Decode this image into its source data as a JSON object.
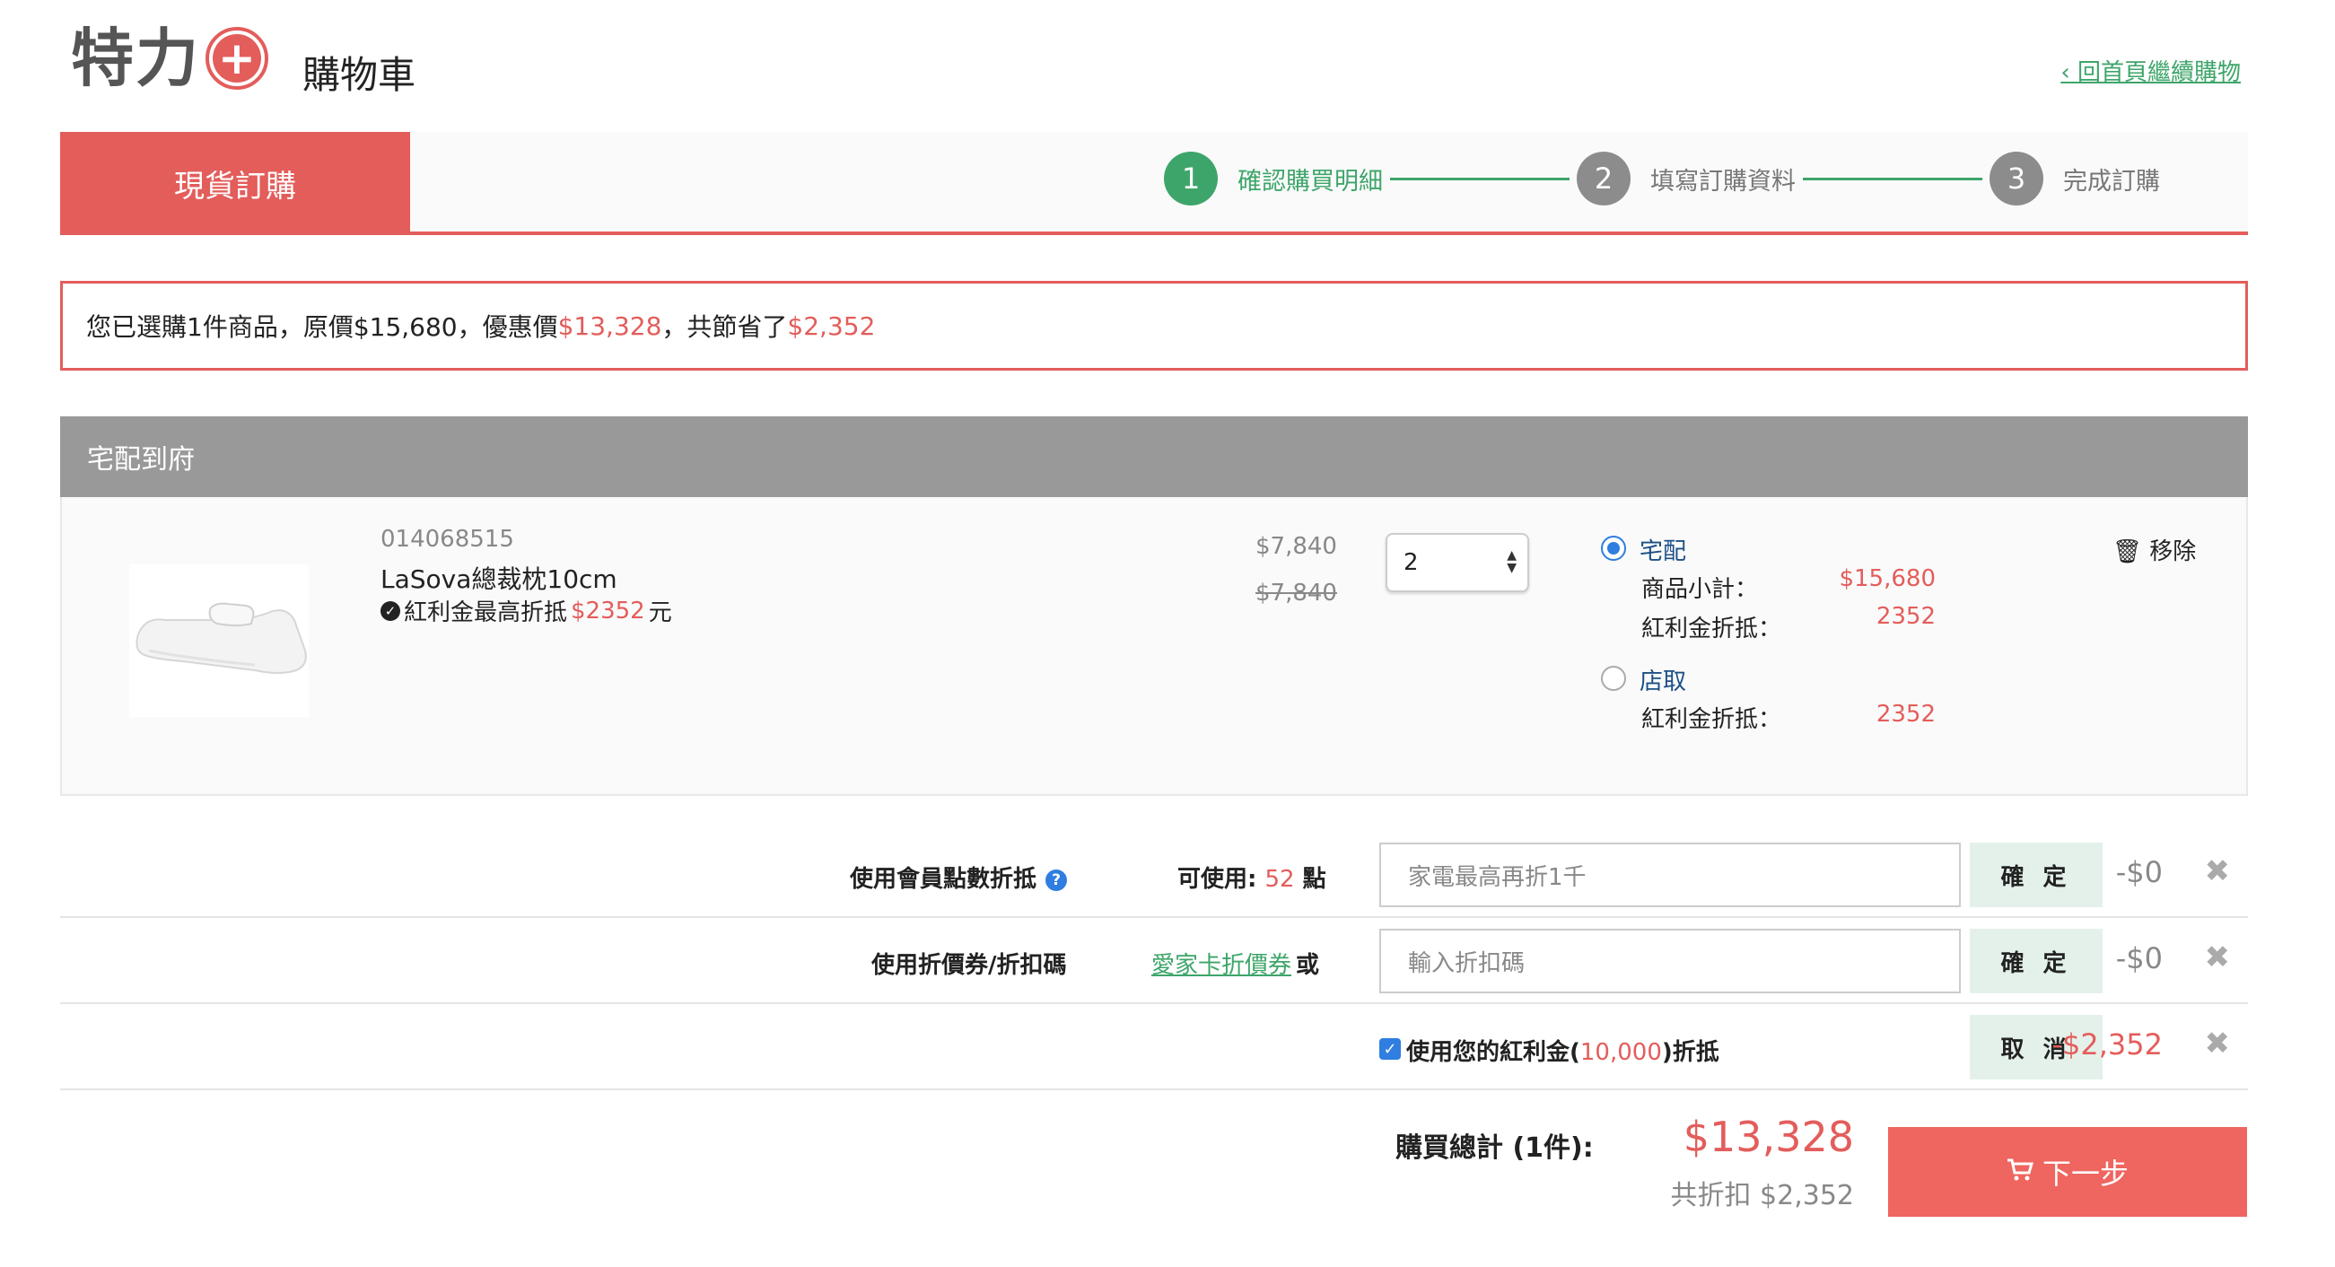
{
  "header": {
    "logo_main": "特力",
    "logo_plus": "+",
    "title": "購物車",
    "back_link": "‹ 回首頁繼續購物"
  },
  "tabs": {
    "active": "現貨訂購"
  },
  "steps": [
    {
      "num": "1",
      "label": "確認購買明細",
      "active": true
    },
    {
      "num": "2",
      "label": "填寫訂購資料",
      "active": false
    },
    {
      "num": "3",
      "label": "完成訂購",
      "active": false
    }
  ],
  "summary": {
    "prefix": "您已選購1件商品，原價$15,680，優惠價",
    "sale_price": "$13,328",
    "middle": "，共節省了",
    "saved": "$2,352"
  },
  "delivery": {
    "section_title": "宅配到府",
    "item": {
      "sku": "014068515",
      "name": "LaSova總裁枕10cm",
      "rebate_prefix": "紅利金最高折抵",
      "rebate_amount": "$2352",
      "rebate_suffix": "元",
      "price": "$7,840",
      "price_old": "$7,840",
      "quantity": "2",
      "remove_label": "移除"
    },
    "options": {
      "home": {
        "label": "宅配",
        "selected": true,
        "subtotal_label": "商品小計：",
        "subtotal_value": "$15,680",
        "rebate_label": "紅利金折抵：",
        "rebate_value": "2352"
      },
      "store": {
        "label": "店取",
        "selected": false,
        "rebate_label": "紅利金折抵：",
        "rebate_value": "2352"
      }
    }
  },
  "discounts": {
    "points": {
      "label": "使用會員點數折抵",
      "available_prefix": "可使用:",
      "available_points": "52",
      "available_suffix": "點",
      "placeholder": "家電最高再折1千",
      "button": "確 定",
      "amount": "-$0"
    },
    "coupon": {
      "label": "使用折價券/折扣碼",
      "link": "愛家卡折價券",
      "or": "或",
      "placeholder": "輸入折扣碼",
      "button": "確 定",
      "amount": "-$0"
    },
    "bonus": {
      "label_prefix": "使用您的紅利金(",
      "bonus_amount": "10,000",
      "label_suffix": ")折抵",
      "checked": true,
      "button": "取 消",
      "amount": "-$2,352"
    }
  },
  "total": {
    "label": "購買總計 (1件):",
    "amount": "$13,328",
    "discount": "共折扣 $2,352",
    "next_button": "下一步"
  },
  "colors": {
    "brand_red": "#e35d5b",
    "step_green": "#3ea56a",
    "step_gray": "#8c8c8c",
    "radio_blue": "#2f7ee0"
  }
}
